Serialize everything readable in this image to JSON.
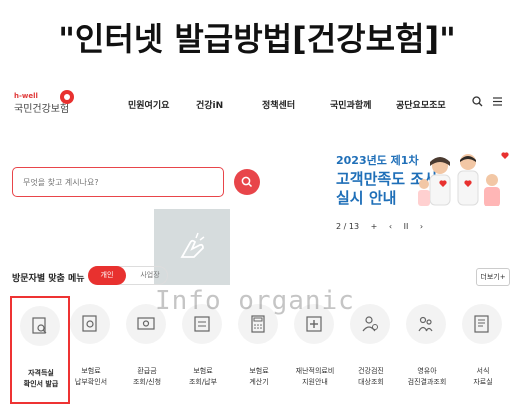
{
  "heading": "\"인터넷 발급방법[건강보험]\"",
  "logo": {
    "tagline": "h-well",
    "name": "국민건강보험"
  },
  "nav": {
    "items": [
      "민원여기요",
      "건강iN",
      "정책센터",
      "국민과함께",
      "공단요모조모"
    ],
    "search_icon": "search-icon",
    "menu_icon": "hamburger-menu-icon"
  },
  "search": {
    "placeholder": "무엇을 찾고 계시나요?",
    "button_icon": "search-icon"
  },
  "banner": {
    "line1": "2023년도 제1차",
    "line2": "고객만족도 조사",
    "line3": "실시 안내",
    "pager": "2 / 13",
    "add": "+",
    "prev": "‹",
    "pause": "II",
    "next": "›"
  },
  "menu": {
    "title": "방문자별 맞춤 메뉴",
    "toggle_on": "개인",
    "toggle_off": "사업장",
    "more": "더보기+",
    "tiles": [
      {
        "l1": "자격득실",
        "l2": "확인서 발급",
        "highlight": true
      },
      {
        "l1": "보험료",
        "l2": "납부확인서"
      },
      {
        "l1": "환급금",
        "l2": "조회/신청"
      },
      {
        "l1": "보험료",
        "l2": "조회/납부"
      },
      {
        "l1": "보험료",
        "l2": "계산기"
      },
      {
        "l1": "재난적의료비",
        "l2": "지원안내"
      },
      {
        "l1": "건강검진",
        "l2": "대상조회"
      },
      {
        "l1": "영유아",
        "l2": "검진결과조회"
      },
      {
        "l1": "서식",
        "l2": "자료실"
      }
    ]
  },
  "watermark": "Info organic",
  "colors": {
    "accent": "#e8312f",
    "banner_blue": "#1f6fb8"
  }
}
